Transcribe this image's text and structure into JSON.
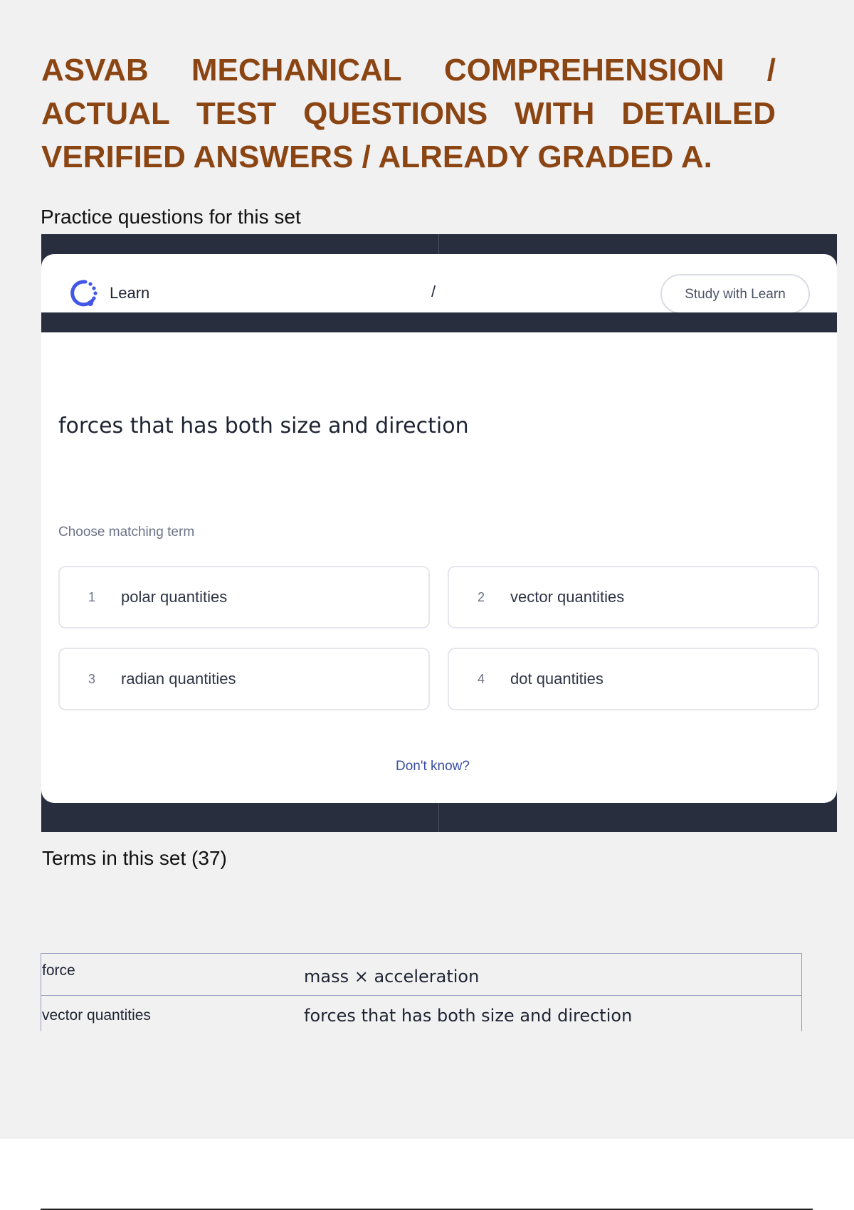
{
  "document": {
    "title": "ASVAB MECHANICAL COMPREHENSION / ACTUAL TEST QUESTIONS WITH DETAILED VERIFIED ANSWERS / ALREADY GRADED A.",
    "title_color": "#8b4513",
    "practice_heading": "Practice questions for this set",
    "terms_heading": "Terms in this set (37)"
  },
  "learn_widget": {
    "mode_label": "Learn",
    "mode_icon": "learn-progress-icon",
    "progress": "/",
    "study_button_label": "Study with Learn",
    "question": "forces that has both size and direction",
    "instruction": "Choose matching term",
    "options": [
      {
        "number": "1",
        "label": "polar quantities"
      },
      {
        "number": "2",
        "label": "vector quantities"
      },
      {
        "number": "3",
        "label": "radian quantities"
      },
      {
        "number": "4",
        "label": "dot quantities"
      }
    ],
    "dont_know_label": "Don't know?",
    "accent_color": "#3b4fa3",
    "frame_color": "#282e3e"
  },
  "terms": [
    {
      "term": "force",
      "definition": "mass × acceleration"
    },
    {
      "term": "vector quantities",
      "definition": "forces that has both size and direction"
    }
  ]
}
